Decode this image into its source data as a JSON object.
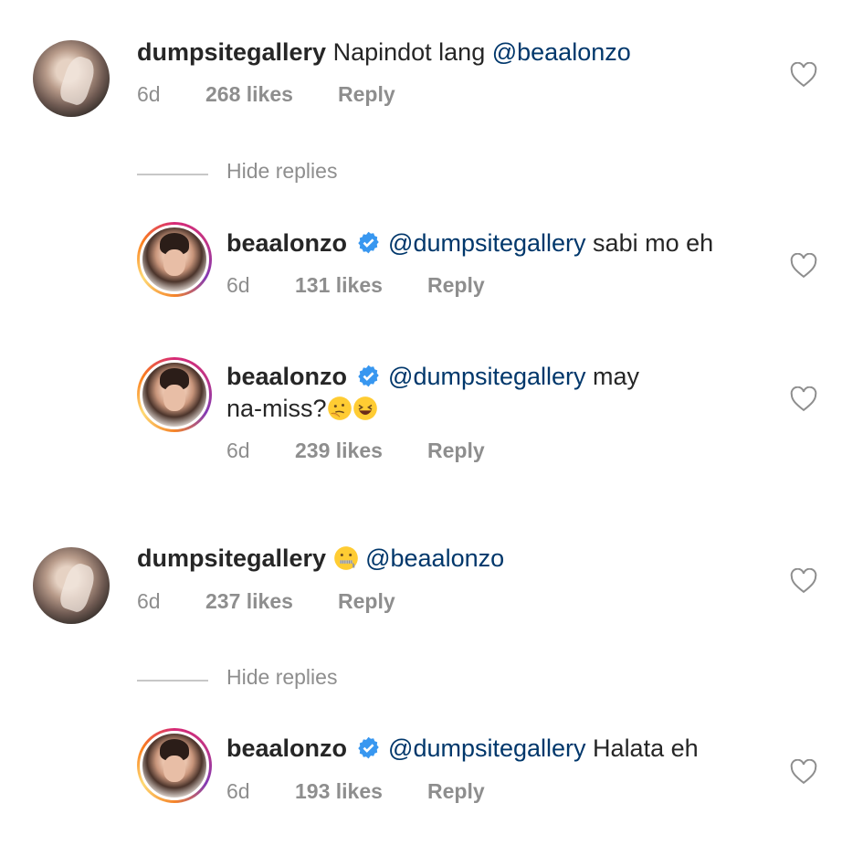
{
  "comments": [
    {
      "user": "dumpsitegallery",
      "mention": "@beaalonzo",
      "text": "Napindot lang ",
      "time": "6d",
      "likes": "268 likes",
      "reply": "Reply"
    },
    {
      "user": "beaalonzo",
      "mention": "@dumpsitegallery",
      "text": " sabi mo eh",
      "time": "6d",
      "likes": "131 likes",
      "reply": "Reply"
    },
    {
      "user": "beaalonzo",
      "mention": "@dumpsitegallery",
      "text": " may",
      "text2": "na-miss?",
      "time": "6d",
      "likes": "239 likes",
      "reply": "Reply"
    },
    {
      "user": "dumpsitegallery",
      "mention": "@beaalonzo",
      "time": "6d",
      "likes": "237 likes",
      "reply": "Reply"
    },
    {
      "user": "beaalonzo",
      "mention": "@dumpsitegallery",
      "text": " Halata eh",
      "time": "6d",
      "likes": "193 likes",
      "reply": "Reply"
    }
  ],
  "hide_replies": "Hide replies",
  "colors": {
    "mention": "#00376b",
    "meta": "#8e8e8e",
    "verified": "#3897f0"
  }
}
